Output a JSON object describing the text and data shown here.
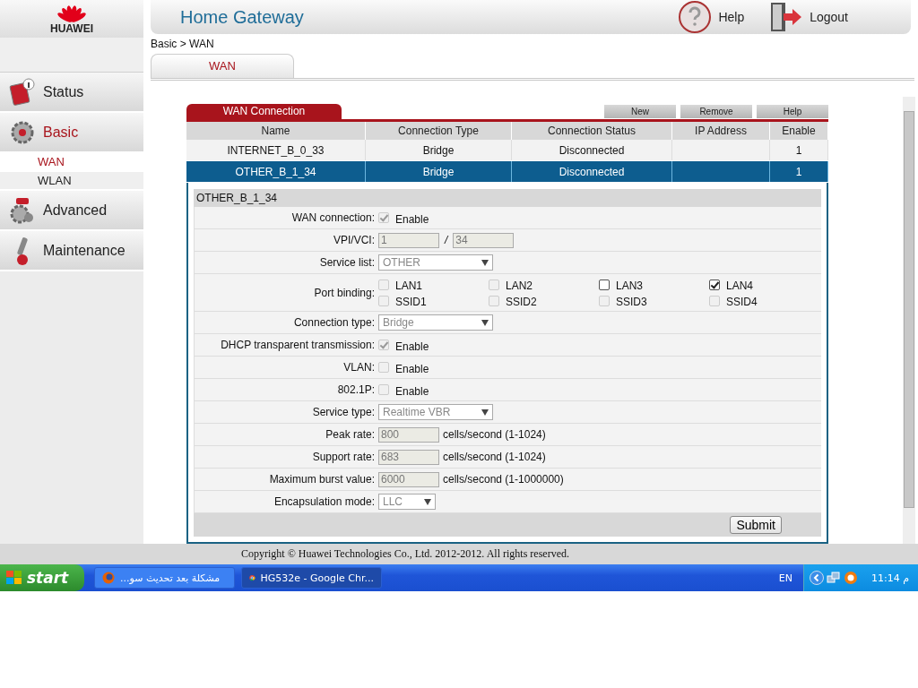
{
  "header": {
    "logo_text": "HUAWEI",
    "title": "Home Gateway",
    "links": [
      {
        "kind": "help",
        "label": "Help"
      },
      {
        "kind": "logout",
        "label": "Logout"
      }
    ]
  },
  "sidebar": {
    "items": [
      {
        "kind": "status",
        "label": "Status",
        "selected": false
      },
      {
        "kind": "basic",
        "label": "Basic",
        "selected": true,
        "children": [
          {
            "label": "WAN",
            "selected": true
          },
          {
            "label": "WLAN",
            "selected": false
          }
        ]
      },
      {
        "kind": "advanced",
        "label": "Advanced",
        "selected": false
      },
      {
        "kind": "maintenance",
        "label": "Maintenance",
        "selected": false
      }
    ]
  },
  "breadcrumb": "Basic > WAN",
  "tabs": [
    {
      "label": "WAN",
      "selected": true
    }
  ],
  "wan_table": {
    "title": "WAN Connection",
    "buttons": [
      "New",
      "Remove",
      "Help"
    ],
    "columns": [
      "Name",
      "Connection Type",
      "Connection Status",
      "IP Address",
      "Enable"
    ],
    "rows": [
      {
        "selected": false,
        "cells": [
          "INTERNET_B_0_33",
          "Bridge",
          "Disconnected",
          "",
          "1"
        ]
      },
      {
        "selected": true,
        "cells": [
          "OTHER_B_1_34",
          "Bridge",
          "Disconnected",
          "",
          "1"
        ]
      }
    ]
  },
  "detail": {
    "title": "OTHER_B_1_34",
    "rows": [
      {
        "kind": "checkbox",
        "label": "WAN connection:",
        "option": "Enable",
        "checked": true,
        "disabled": true
      },
      {
        "kind": "vpi_vci",
        "label": "VPI/VCI:",
        "values": [
          "1",
          "34"
        ],
        "separator": "/"
      },
      {
        "kind": "select",
        "label": "Service list:",
        "value": "OTHER"
      },
      {
        "kind": "ports",
        "label": "Port binding:",
        "ports": [
          {
            "label": "LAN1",
            "checked": false,
            "disabled": true
          },
          {
            "label": "LAN2",
            "checked": false,
            "disabled": true
          },
          {
            "label": "LAN3",
            "checked": false,
            "disabled": false
          },
          {
            "label": "LAN4",
            "checked": true,
            "disabled": false
          },
          {
            "label": "SSID1",
            "checked": false,
            "disabled": true
          },
          {
            "label": "SSID2",
            "checked": false,
            "disabled": true
          },
          {
            "label": "SSID3",
            "checked": false,
            "disabled": true
          },
          {
            "label": "SSID4",
            "checked": false,
            "disabled": true
          }
        ]
      },
      {
        "kind": "select",
        "label": "Connection type:",
        "value": "Bridge"
      },
      {
        "kind": "checkbox",
        "label": "DHCP transparent transmission:",
        "option": "Enable",
        "checked": true,
        "disabled": true
      },
      {
        "kind": "checkbox",
        "label": "VLAN:",
        "option": "Enable",
        "checked": false,
        "disabled": true
      },
      {
        "kind": "checkbox",
        "label": "802.1P:",
        "option": "Enable",
        "checked": false,
        "disabled": true
      },
      {
        "kind": "select",
        "label": "Service type:",
        "value": "Realtime VBR"
      },
      {
        "kind": "input",
        "label": "Peak rate:",
        "value": "800",
        "hint": "cells/second (1-1024)"
      },
      {
        "kind": "input",
        "label": "Support rate:",
        "value": "683",
        "hint": "cells/second (1-1024)"
      },
      {
        "kind": "input",
        "label": "Maximum burst value:",
        "value": "6000",
        "hint": "cells/second (1-1000000)"
      },
      {
        "kind": "select",
        "label": "Encapsulation mode:",
        "value": "LLC"
      }
    ],
    "submit": "Submit"
  },
  "footer": "Copyright © Huawei Technologies Co., Ltd. 2012-2012. All rights reserved.",
  "taskbar": {
    "start": "start",
    "tasks": [
      {
        "kind": "firefox",
        "label": "...مشكلة بعد تحديث سو",
        "selected": false
      },
      {
        "kind": "chrome",
        "label": "HG532e - Google Chr...",
        "selected": true
      }
    ],
    "language": "EN",
    "clock": "11:14 م"
  }
}
